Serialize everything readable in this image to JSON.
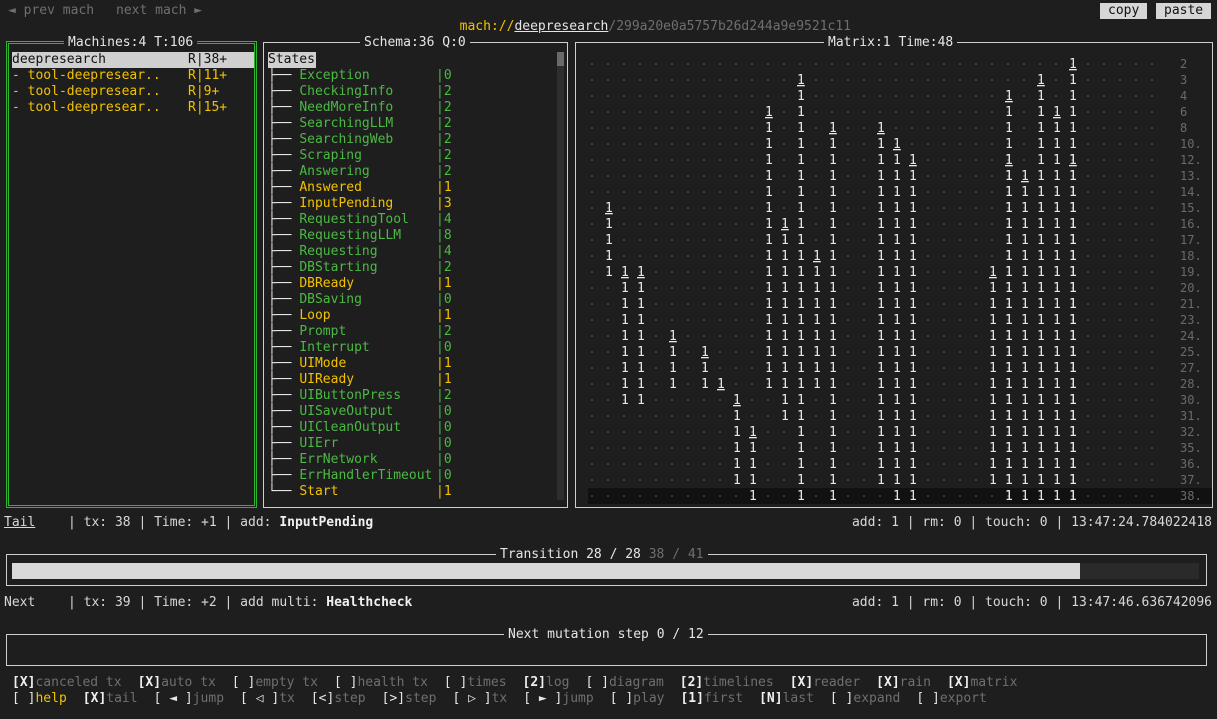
{
  "topbar": {
    "prev": "◄ prev mach",
    "next": "next mach ►",
    "url_prefix": "mach://",
    "url_name": "deepresearch",
    "url_id": "/299a20e0a5757b26d244a9e9521c11",
    "copy": "copy",
    "paste": "paste"
  },
  "machines": {
    "title": "Machines:4 T:106",
    "items": [
      {
        "name": "deepresearch",
        "status": "R|38+",
        "selected": true
      },
      {
        "name": "- tool-deepresear..",
        "status": "R|11+",
        "selected": false
      },
      {
        "name": "- tool-deepresear..",
        "status": "R|9+",
        "selected": false
      },
      {
        "name": "- tool-deepresear..",
        "status": "R|15+",
        "selected": false
      }
    ]
  },
  "schema": {
    "title": "Schema:36 Q:0",
    "header": "States",
    "states": [
      {
        "name": "Exception",
        "count": "|0",
        "active": false
      },
      {
        "name": "CheckingInfo",
        "count": "|2",
        "active": false
      },
      {
        "name": "NeedMoreInfo",
        "count": "|2",
        "active": false
      },
      {
        "name": "SearchingLLM",
        "count": "|2",
        "active": false
      },
      {
        "name": "SearchingWeb",
        "count": "|2",
        "active": false
      },
      {
        "name": "Scraping",
        "count": "|2",
        "active": false
      },
      {
        "name": "Answering",
        "count": "|2",
        "active": false
      },
      {
        "name": "Answered",
        "count": "|1",
        "active": true
      },
      {
        "name": "InputPending",
        "count": "|3",
        "active": true
      },
      {
        "name": "RequestingTool",
        "count": "|4",
        "active": false
      },
      {
        "name": "RequestingLLM",
        "count": "|8",
        "active": false
      },
      {
        "name": "Requesting",
        "count": "|4",
        "active": false
      },
      {
        "name": "DBStarting",
        "count": "|2",
        "active": false
      },
      {
        "name": "DBReady",
        "count": "|1",
        "active": true
      },
      {
        "name": "DBSaving",
        "count": "|0",
        "active": false
      },
      {
        "name": "Loop",
        "count": "|1",
        "active": true
      },
      {
        "name": "Prompt",
        "count": "|2",
        "active": false
      },
      {
        "name": "Interrupt",
        "count": "|0",
        "active": false
      },
      {
        "name": "UIMode",
        "count": "|1",
        "active": true
      },
      {
        "name": "UIReady",
        "count": "|1",
        "active": true
      },
      {
        "name": "UIButtonPress",
        "count": "|2",
        "active": false
      },
      {
        "name": "UISaveOutput",
        "count": "|0",
        "active": false
      },
      {
        "name": "UICleanOutput",
        "count": "|0",
        "active": false
      },
      {
        "name": "UIErr",
        "count": "|0",
        "active": false
      },
      {
        "name": "ErrNetwork",
        "count": "|0",
        "active": false
      },
      {
        "name": "ErrHandlerTimeout",
        "count": "|0",
        "active": false
      },
      {
        "name": "Start",
        "count": "|1",
        "active": true
      }
    ]
  },
  "matrix": {
    "title": "Matrix:1 Time:48",
    "row_labels": [
      "2",
      "3",
      "4",
      "6",
      "8",
      "10.",
      "12.",
      "13.",
      "14.",
      "15.",
      "16.",
      "17.",
      "18.",
      "19.",
      "20.",
      "21.",
      "23.",
      "24.",
      "25.",
      "27.",
      "28.",
      "30.",
      "31.",
      "32.",
      "35.",
      "36.",
      "37.",
      "38."
    ]
  },
  "tail": {
    "label": "Tail",
    "info": "| tx: 38 | Time: +1 | add: ",
    "state": "InputPending",
    "right": "add: 1 | rm: 0 | touch: 0 | 13:47:24.784022418"
  },
  "transition": {
    "title_main": "Transition 28 / 28",
    "title_dim": " 38 / 41",
    "progress": 0.9
  },
  "next": {
    "label": "Next",
    "info": "| tx: 39 | Time: +2 | add multi: ",
    "state": "Healthcheck",
    "right": "add: 1 | rm: 0 | touch: 0 | 13:47:46.636742096"
  },
  "mutation": {
    "title": "Next mutation step 0 / 12"
  },
  "toolbar_row1": [
    {
      "key": "[X]",
      "label": "canceled tx"
    },
    {
      "key": "[X]",
      "label": "auto tx"
    },
    {
      "key": "[ ]",
      "label": "empty tx"
    },
    {
      "key": "[ ]",
      "label": "health tx"
    },
    {
      "key": "[ ]",
      "label": "times"
    },
    {
      "key": "[2]",
      "label": "log"
    },
    {
      "key": "[ ]",
      "label": "diagram"
    },
    {
      "key": "[2]",
      "label": "timelines"
    },
    {
      "key": "[X]",
      "label": "reader"
    },
    {
      "key": "[X]",
      "label": "rain"
    },
    {
      "key": "[X]",
      "label": "matrix"
    }
  ],
  "toolbar_row2": [
    {
      "key": "[ ]",
      "label": "help"
    },
    {
      "key": "[X]",
      "label": "tail"
    },
    {
      "key": "[ ◄ ]",
      "label": "jump"
    },
    {
      "key": "[ ◁ ]",
      "label": "tx"
    },
    {
      "key": "[<]",
      "label": "step"
    },
    {
      "key": "[>]",
      "label": "step"
    },
    {
      "key": "[ ▷ ]",
      "label": "tx"
    },
    {
      "key": "[ ► ]",
      "label": "jump"
    },
    {
      "key": "[ ]",
      "label": "play"
    },
    {
      "key": "[1]",
      "label": "first"
    },
    {
      "key": "[N]",
      "label": "last"
    },
    {
      "key": "[ ]",
      "label": "expand"
    },
    {
      "key": "[ ]",
      "label": "export"
    }
  ]
}
